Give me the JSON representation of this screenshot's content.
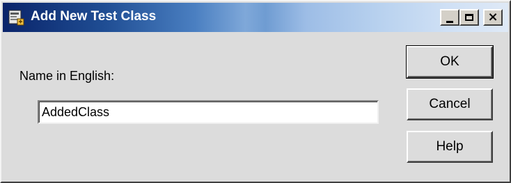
{
  "window": {
    "title": "Add New Test Class"
  },
  "titlebar_buttons": {
    "minimize_icon": "minimize-icon",
    "maximize_icon": "maximize-icon",
    "close_icon": "close-icon"
  },
  "form": {
    "name_label": "Name in English:",
    "name_value": "AddedClass"
  },
  "buttons": {
    "ok": "OK",
    "cancel": "Cancel",
    "help": "Help"
  },
  "colors": {
    "titlebar_start": "#0a246a",
    "titlebar_end": "#dfe9f6",
    "dialog_face": "#dcdcdc"
  }
}
